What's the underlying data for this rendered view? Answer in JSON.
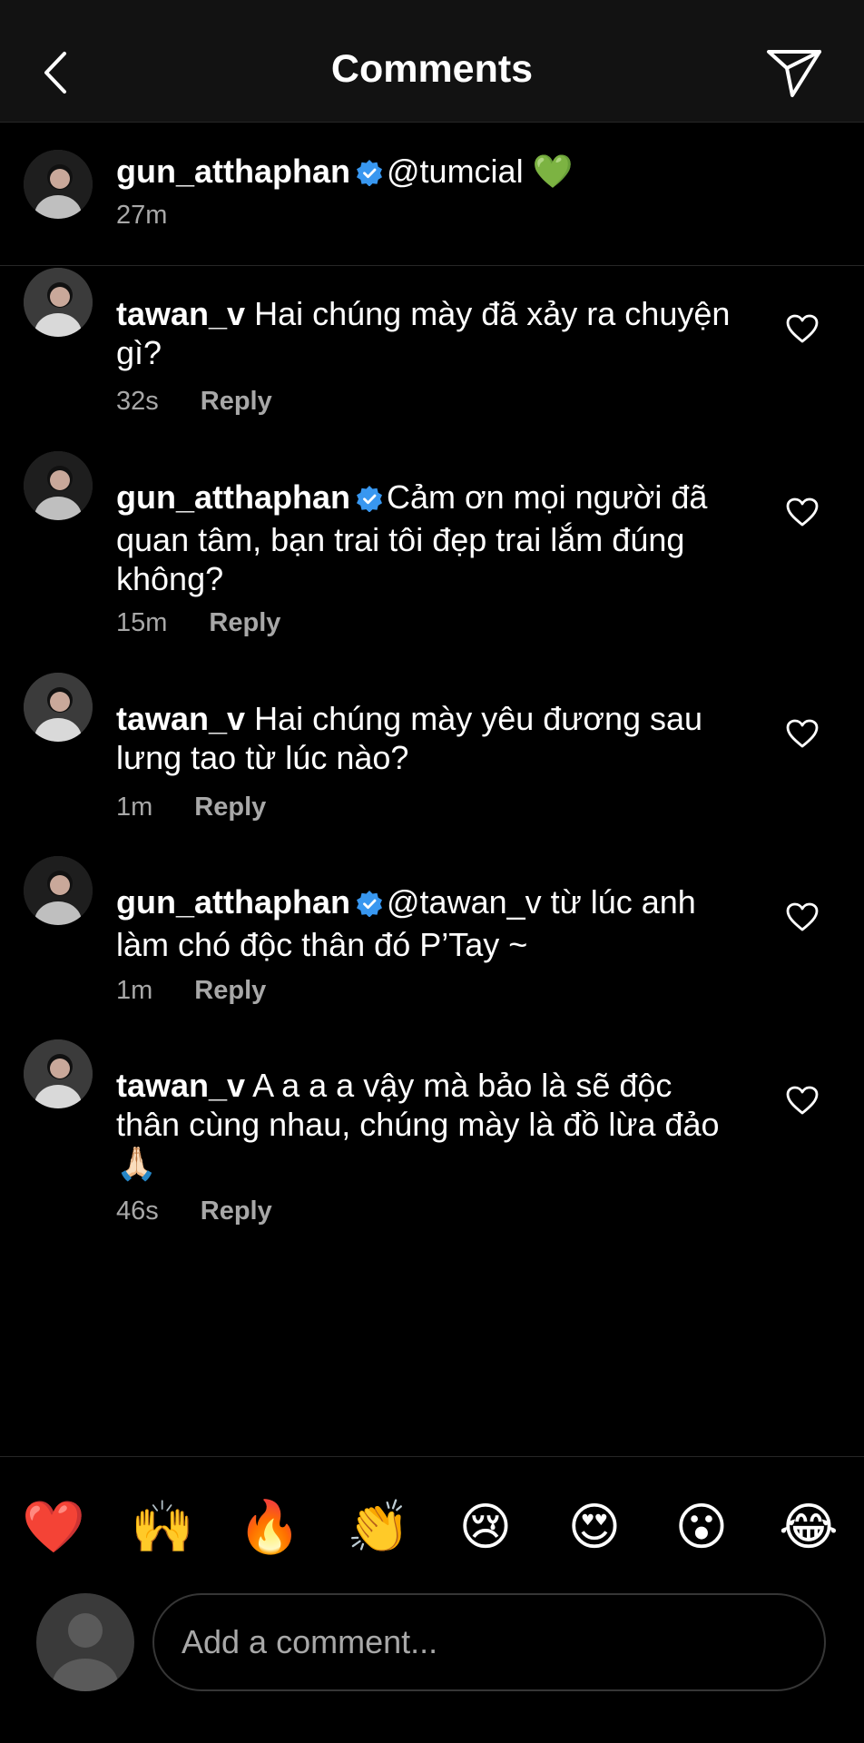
{
  "header": {
    "title": "Comments"
  },
  "caption": {
    "username": "gun_atthaphan",
    "verified": true,
    "text": "@tumcial 💚",
    "time": "27m"
  },
  "comments": [
    {
      "username": "tawan_v",
      "verified": false,
      "text": "Hai chúng mày đã xảy ra chuyện gì?",
      "time": "32s",
      "reply_label": "Reply"
    },
    {
      "username": "gun_atthaphan",
      "verified": true,
      "text": "Cảm ơn mọi người đã quan tâm, bạn trai tôi đẹp trai lắm đúng không?",
      "time": "15m",
      "reply_label": "Reply"
    },
    {
      "username": "tawan_v",
      "verified": false,
      "text": "Hai chúng mày yêu đương sau lưng tao từ lúc nào?",
      "time": "1m",
      "reply_label": "Reply"
    },
    {
      "username": "gun_atthaphan",
      "verified": true,
      "text": "@tawan_v từ lúc anh làm chó độc thân đó P’Tay ~",
      "time": "1m",
      "reply_label": "Reply"
    },
    {
      "username": "tawan_v",
      "verified": false,
      "text": "A a a a vậy mà bảo là sẽ độc thân cùng nhau, chúng mày là đồ lừa đảo 🙏🏻",
      "time": "46s",
      "reply_label": "Reply"
    }
  ],
  "quick_emojis": [
    "❤️",
    "🙌",
    "🔥",
    "👏",
    "😢",
    "😍",
    "😮",
    "😂"
  ],
  "composer": {
    "placeholder": "Add a comment..."
  },
  "colors": {
    "background": "#000000",
    "header": "#121212",
    "verified_blue": "#3897f0",
    "muted": "#a8a8a8"
  }
}
